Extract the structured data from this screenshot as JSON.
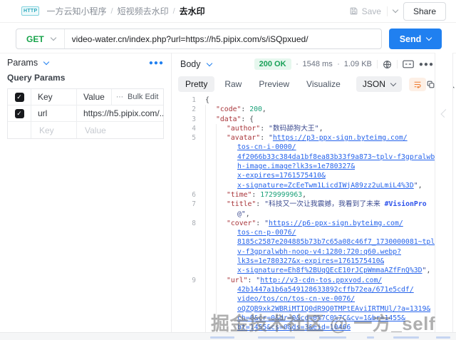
{
  "topbar": {
    "breadcrumb": [
      "一方云知小程序",
      "短视频去水印",
      "去水印"
    ],
    "save_label": "Save",
    "share_label": "Share"
  },
  "request": {
    "method": "GET",
    "url": "video-water.cn/index.php?url=https://h5.pipix.com/s/iSQpxued/",
    "send_label": "Send"
  },
  "params": {
    "title": "Params",
    "section_title": "Query Params",
    "col_key": "Key",
    "col_value": "Value",
    "bulk_edit": "Bulk Edit",
    "row": {
      "key": "url",
      "value": "https://h5.pipix.com/..."
    },
    "key_placeholder": "Key",
    "value_placeholder": "Value"
  },
  "response": {
    "body_label": "Body",
    "status": "200 OK",
    "duration": "1548 ms",
    "size": "1.09 KB",
    "tabs": [
      "Pretty",
      "Raw",
      "Preview",
      "Visualize"
    ],
    "active_tab": "Pretty",
    "format": "JSON"
  },
  "json_viewer": {
    "rows": [
      {
        "n": "1",
        "i": 0,
        "s": [
          {
            "t": "{",
            "c": "p"
          }
        ]
      },
      {
        "n": "2",
        "i": 1,
        "s": [
          {
            "t": "\"code\"",
            "c": "k"
          },
          {
            "t": ": ",
            "c": "p"
          },
          {
            "t": "200",
            "c": "n"
          },
          {
            "t": ",",
            "c": "p"
          }
        ]
      },
      {
        "n": "3",
        "i": 1,
        "s": [
          {
            "t": "\"data\"",
            "c": "k"
          },
          {
            "t": ": {",
            "c": "p"
          }
        ]
      },
      {
        "n": "4",
        "i": 2,
        "s": [
          {
            "t": "\"author\"",
            "c": "k"
          },
          {
            "t": ": ",
            "c": "p"
          },
          {
            "t": "\"数码舔狗大王\"",
            "c": "s"
          },
          {
            "t": ",",
            "c": "p"
          }
        ]
      },
      {
        "n": "5",
        "i": 2,
        "s": [
          {
            "t": "\"avatar\"",
            "c": "k"
          },
          {
            "t": ": ",
            "c": "p"
          },
          {
            "t": "\"",
            "c": "s"
          },
          {
            "t": "https://p3-ppx-sign.byteimg.com/",
            "c": "l"
          }
        ]
      },
      {
        "n": "",
        "i": 3,
        "s": [
          {
            "t": "tos-cn-i-0000/",
            "c": "l"
          }
        ]
      },
      {
        "n": "",
        "i": 3,
        "s": [
          {
            "t": "4f2066b33c384da1bf8ea83b33f9a873~tplv-f3gpralwb",
            "c": "l"
          }
        ]
      },
      {
        "n": "",
        "i": 3,
        "s": [
          {
            "t": "h-image.image?lk3s=1e780327&",
            "c": "l"
          }
        ]
      },
      {
        "n": "",
        "i": 3,
        "s": [
          {
            "t": "x-expires=1761575410&",
            "c": "l"
          }
        ]
      },
      {
        "n": "",
        "i": 3,
        "s": [
          {
            "t": "x-signature=ZcEeTwm1LicdIWjA89zz2uLmiL4%3D",
            "c": "l"
          },
          {
            "t": "\"",
            "c": "s"
          },
          {
            "t": ",",
            "c": "p"
          }
        ]
      },
      {
        "n": "6",
        "i": 2,
        "s": [
          {
            "t": "\"time\"",
            "c": "k"
          },
          {
            "t": ": ",
            "c": "p"
          },
          {
            "t": "1729999963",
            "c": "n"
          },
          {
            "t": ",",
            "c": "p"
          }
        ]
      },
      {
        "n": "7",
        "i": 2,
        "s": [
          {
            "t": "\"title\"",
            "c": "k"
          },
          {
            "t": ": ",
            "c": "p"
          },
          {
            "t": "\"科技又一次让我震撼，我看到了未来 ",
            "c": "s"
          },
          {
            "t": "#VisionPro",
            "c": "h"
          }
        ]
      },
      {
        "n": "",
        "i": 3,
        "s": [
          {
            "t": "@\"",
            "c": "s"
          },
          {
            "t": ",",
            "c": "p"
          }
        ]
      },
      {
        "n": "8",
        "i": 2,
        "s": [
          {
            "t": "\"cover\"",
            "c": "k"
          },
          {
            "t": ": ",
            "c": "p"
          },
          {
            "t": "\"",
            "c": "s"
          },
          {
            "t": "https://p6-ppx-sign.byteimg.com/",
            "c": "l"
          }
        ]
      },
      {
        "n": "",
        "i": 3,
        "s": [
          {
            "t": "tos-cn-p-0076/",
            "c": "l"
          }
        ]
      },
      {
        "n": "",
        "i": 3,
        "s": [
          {
            "t": "8185c2587e204885b73b7c65a08c46f7_1730000081~tpl",
            "c": "l"
          }
        ]
      },
      {
        "n": "",
        "i": 3,
        "s": [
          {
            "t": "v-f3gpralwbh-noop-v4:1280:720:q60.webp?",
            "c": "l"
          }
        ]
      },
      {
        "n": "",
        "i": 3,
        "s": [
          {
            "t": "lk3s=1e780327&x-expires=1761575410&",
            "c": "l"
          }
        ]
      },
      {
        "n": "",
        "i": 3,
        "s": [
          {
            "t": "x-signature=Eh8f%2BUqQEcE10rJCpWmmaAZfFnQ%3D",
            "c": "l"
          },
          {
            "t": "\"",
            "c": "s"
          },
          {
            "t": ",",
            "c": "p"
          }
        ]
      },
      {
        "n": "9",
        "i": 2,
        "s": [
          {
            "t": "\"url\"",
            "c": "k"
          },
          {
            "t": ": ",
            "c": "p"
          },
          {
            "t": "\"",
            "c": "s"
          },
          {
            "t": "http://v3-cdn-tos.ppxvod.com/",
            "c": "l"
          }
        ]
      },
      {
        "n": "",
        "i": 3,
        "s": [
          {
            "t": "42b1447a1b6a549128633892cffb72ea/671e5cdf/",
            "c": "l"
          }
        ]
      },
      {
        "n": "",
        "i": 3,
        "s": [
          {
            "t": "video/tos/cn/tos-cn-ve-0076/",
            "c": "l"
          }
        ]
      },
      {
        "n": "",
        "i": 3,
        "s": [
          {
            "t": "oQZQB9xk2WBRiMTIQ0dR9Q0TMPtEAviIRTMUl/?a=1319&",
            "c": "l"
          }
        ]
      },
      {
        "n": "",
        "i": 3,
        "s": [
          {
            "t": "ch=0&cr=0&dr=0&cd=0%7C0%7C&cv=1&br=1455&",
            "c": "l"
          }
        ]
      },
      {
        "n": "",
        "i": 3,
        "s": [
          {
            "t": "bt=1455&cs=0&ds=3&eid=10466",
            "c": "l"
          }
        ]
      }
    ]
  },
  "watermark": "掘金技术社区 @ 一方_self",
  "colors": {
    "accent": "#2080f0",
    "method_get": "#17a34a",
    "status_ok": "#18a058",
    "link": "#2563eb",
    "json_key": "#a8353a",
    "json_number": "#1aa179",
    "json_string": "#3b4a8f"
  }
}
